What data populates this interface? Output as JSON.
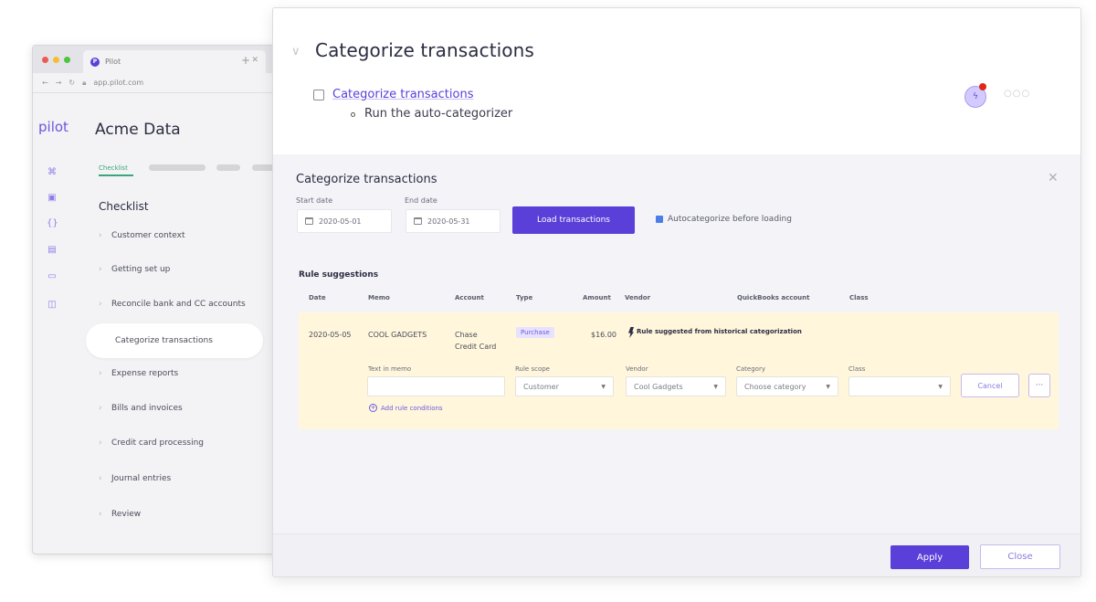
{
  "browser": {
    "tab_title": "Pilot",
    "tab_icon": "pilot-favicon",
    "address": "app.pilot.com",
    "brand": "pilot",
    "org_title": "Acme Data",
    "active_tab": "Checklist",
    "checklist_heading": "Checklist",
    "checklist_items": [
      {
        "label": "Customer context"
      },
      {
        "label": "Getting set up"
      },
      {
        "label": "Reconcile bank and CC accounts"
      },
      {
        "label": "Categorize transactions"
      },
      {
        "label": "Expense reports"
      },
      {
        "label": "Bills and invoices"
      },
      {
        "label": "Credit card processing"
      },
      {
        "label": "Journal entries"
      },
      {
        "label": "Review"
      }
    ]
  },
  "dialog": {
    "title": "Categorize transactions",
    "task_link": "Categorize transactions",
    "task_subitem": "Run the auto-categorizer",
    "panel": {
      "title": "Categorize transactions",
      "start_date_label": "Start date",
      "start_date_value": "2020-05-01",
      "end_date_label": "End date",
      "end_date_value": "2020-05-31",
      "load_button": "Load transactions",
      "autocategorize_label": "Autocategorize before loading",
      "autocategorize_checked": true,
      "rule_suggestions_label": "Rule suggestions",
      "columns": [
        "Date",
        "Memo",
        "Account",
        "Type",
        "Amount",
        "Vendor",
        "QuickBooks account",
        "Class"
      ],
      "row": {
        "date": "2020-05-05",
        "memo": "COOL GADGETS",
        "account_line1": "Chase",
        "account_line2": "Credit Card",
        "type": "Purchase",
        "amount": "$16.00",
        "suggestion": "Rule suggested from historical categorization"
      },
      "rule_form": {
        "memo_label": "Text in memo",
        "memo_value": "",
        "scope_label": "Rule scope",
        "scope_value": "Customer",
        "vendor_label": "Vendor",
        "vendor_value": "Cool Gadgets",
        "category_label": "Category",
        "category_placeholder": "Choose category",
        "class_label": "Class",
        "class_value": "",
        "cancel_button": "Cancel",
        "more_button": "···",
        "add_conditions": "Add rule conditions"
      }
    },
    "footer": {
      "apply_button": "Apply",
      "close_button": "Close"
    }
  },
  "colors": {
    "accent": "#5b3fd9",
    "suggestion_row": "#fff6dc",
    "panel_bg": "#f3f3f8"
  }
}
